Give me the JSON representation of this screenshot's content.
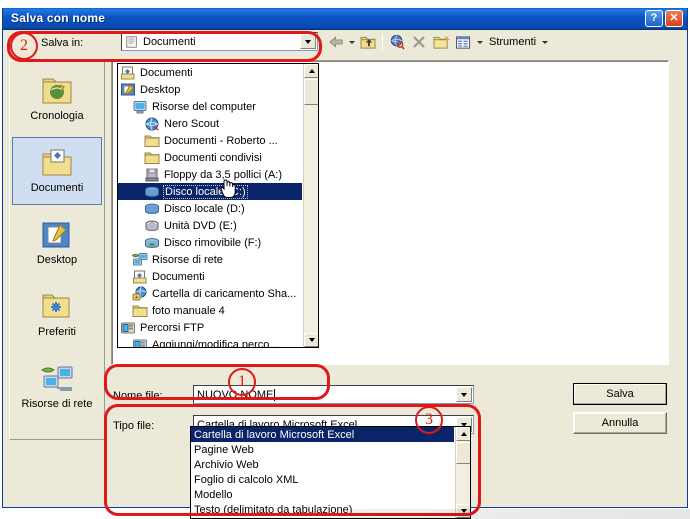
{
  "window": {
    "title": "Salva con nome",
    "help_button": "?",
    "close_button": "✕"
  },
  "toolbar": {
    "savein_label": "Salva in:",
    "savein_value": "Documenti",
    "tools_label": "Strumenti",
    "icons": [
      "back-arrow-icon",
      "up-folder-icon",
      "search-web-icon",
      "delete-x-icon",
      "new-folder-icon",
      "views-icon"
    ]
  },
  "sidebar": {
    "items": [
      {
        "label": "Cronologia",
        "icon": "history-folder-icon",
        "selected": false
      },
      {
        "label": "Documenti",
        "icon": "my-documents-icon",
        "selected": true
      },
      {
        "label": "Desktop",
        "icon": "desktop-icon",
        "selected": false
      },
      {
        "label": "Preferiti",
        "icon": "favorites-folder-icon",
        "selected": false
      },
      {
        "label": "Risorse di rete",
        "icon": "network-places-icon",
        "selected": false
      }
    ]
  },
  "location_dropdown": {
    "items": [
      {
        "label": "Documenti",
        "icon": "my-documents-icon",
        "indent": 0,
        "selected": false
      },
      {
        "label": "Desktop",
        "icon": "desktop-icon",
        "indent": 0,
        "selected": false
      },
      {
        "label": "Risorse del computer",
        "icon": "my-computer-icon",
        "indent": 1,
        "selected": false
      },
      {
        "label": "Nero Scout",
        "icon": "nero-scout-icon",
        "indent": 2,
        "selected": false
      },
      {
        "label": "Documenti - Roberto ...",
        "icon": "folder-icon",
        "indent": 2,
        "selected": false
      },
      {
        "label": "Documenti condivisi",
        "icon": "folder-icon",
        "indent": 2,
        "selected": false
      },
      {
        "label": "Floppy da 3,5 pollici (A:)",
        "icon": "floppy-drive-icon",
        "indent": 2,
        "selected": false
      },
      {
        "label": "Disco locale (C:)",
        "icon": "hard-drive-icon",
        "indent": 2,
        "selected": true
      },
      {
        "label": "Disco locale (D:)",
        "icon": "hard-drive-icon",
        "indent": 2,
        "selected": false
      },
      {
        "label": "Unità DVD (E:)",
        "icon": "dvd-drive-icon",
        "indent": 2,
        "selected": false
      },
      {
        "label": "Disco rimovibile (F:)",
        "icon": "removable-drive-icon",
        "indent": 2,
        "selected": false
      },
      {
        "label": "Risorse di rete",
        "icon": "network-places-icon",
        "indent": 1,
        "selected": false
      },
      {
        "label": "Documenti",
        "icon": "my-documents-icon",
        "indent": 1,
        "selected": false
      },
      {
        "label": "Cartella di caricamento Sha...",
        "icon": "shared-upload-icon",
        "indent": 1,
        "selected": false
      },
      {
        "label": "foto manuale 4",
        "icon": "folder-icon",
        "indent": 1,
        "selected": false
      },
      {
        "label": "Percorsi FTP",
        "icon": "ftp-icon",
        "indent": 0,
        "selected": false
      },
      {
        "label": "Aggiungi/modifica perco...",
        "icon": "ftp-add-icon",
        "indent": 1,
        "selected": false
      }
    ]
  },
  "fields": {
    "filename_label": "Nome file:",
    "filename_value": "NUOVO NOME",
    "filetype_label": "Tipo file:",
    "filetype_value": "Cartella di lavoro Microsoft Excel"
  },
  "filetype_dropdown": {
    "items": [
      {
        "label": "Cartella di lavoro Microsoft Excel",
        "selected": true
      },
      {
        "label": "Pagine Web",
        "selected": false
      },
      {
        "label": "Archivio Web",
        "selected": false
      },
      {
        "label": "Foglio di calcolo XML",
        "selected": false
      },
      {
        "label": "Modello",
        "selected": false
      },
      {
        "label": "Testo (delimitato da tabulazione)",
        "selected": false
      }
    ]
  },
  "buttons": {
    "save": "Salva",
    "cancel": "Annulla"
  },
  "annotations": {
    "marker_1": "1",
    "marker_2": "2",
    "marker_3": "3",
    "color": "#e01818"
  }
}
